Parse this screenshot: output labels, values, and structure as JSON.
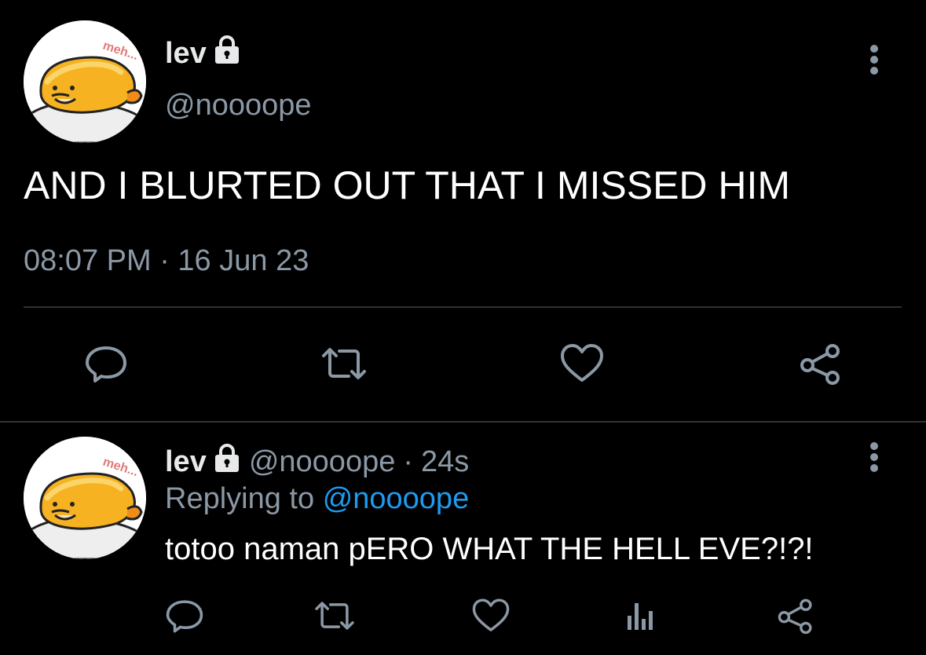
{
  "colors": {
    "background": "#000000",
    "text": "#e7e9ea",
    "muted": "#8b98a5",
    "link": "#1d9bf0",
    "divider": "#2f3336"
  },
  "main_tweet": {
    "display_name": "lev",
    "handle": "@noooope",
    "text": "AND I BLURTED OUT THAT I MISSED HIM",
    "timestamp": "08:07 PM · 16 Jun 23",
    "avatar_caption": "meh...",
    "icons": [
      "lock-icon",
      "more-icon",
      "reply-icon",
      "retweet-icon",
      "like-icon",
      "share-icon"
    ]
  },
  "reply_tweet": {
    "display_name": "lev",
    "handle": "@noooope",
    "separator": "·",
    "time": "24s",
    "replying_prefix": "Replying to",
    "replying_handle": "@noooope",
    "text": "totoo naman pERO WHAT THE HELL EVE?!?!",
    "avatar_caption": "meh...",
    "icons": [
      "lock-icon",
      "more-icon",
      "reply-icon",
      "retweet-icon",
      "like-icon",
      "analytics-icon",
      "share-icon"
    ]
  }
}
